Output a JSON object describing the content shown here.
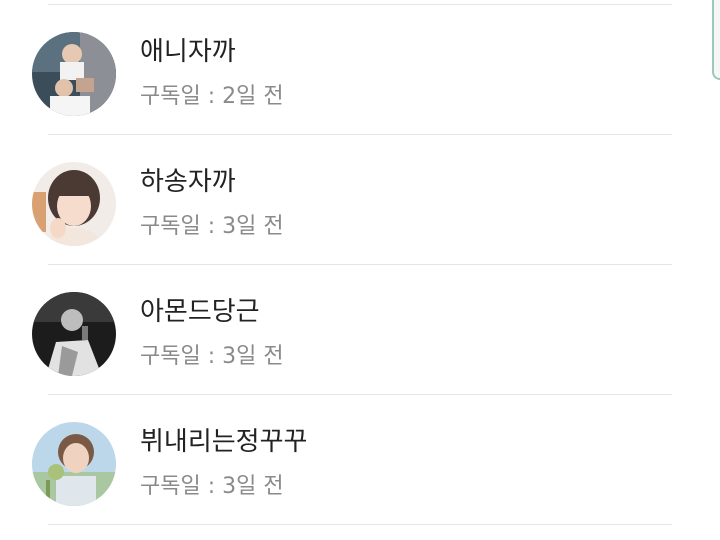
{
  "subscriptions": [
    {
      "name": "애니자까",
      "subscribed": "구독일 : 2일 전",
      "avatar": "avatar-photo"
    },
    {
      "name": "하송자까",
      "subscribed": "구독일 : 3일 전",
      "avatar": "avatar-photo"
    },
    {
      "name": "아몬드당근",
      "subscribed": "구독일 : 3일 전",
      "avatar": "avatar-photo"
    },
    {
      "name": "뷔내리는정꾸꾸",
      "subscribed": "구독일 : 3일 전",
      "avatar": "avatar-photo"
    }
  ],
  "colors": {
    "name_text": "#222222",
    "sub_text": "#8a8a8a",
    "divider": "#e6e6e6",
    "scroll_accent": "#9fc7bd"
  }
}
